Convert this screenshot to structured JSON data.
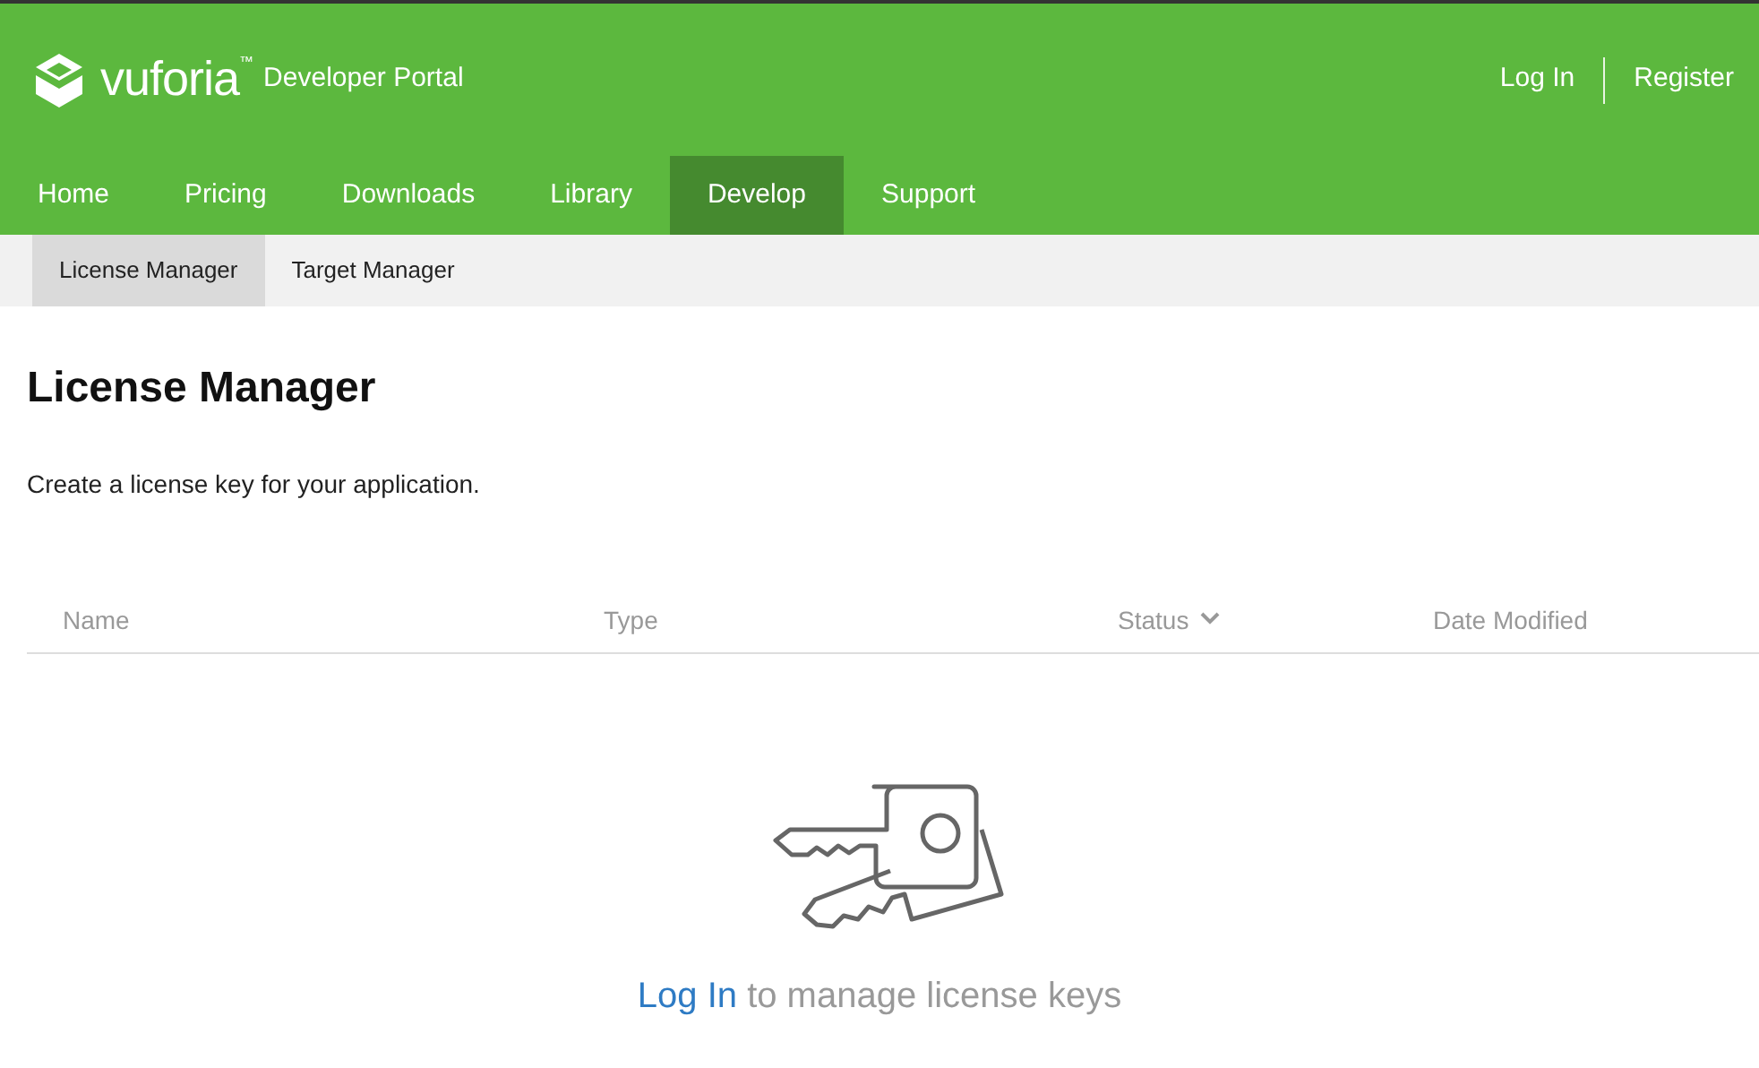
{
  "brand": {
    "name": "vuforia",
    "trademark": "™",
    "subtitle": "Developer Portal"
  },
  "account_links": [
    "Log In",
    "Register"
  ],
  "nav": [
    {
      "label": "Home",
      "selected": false
    },
    {
      "label": "Pricing",
      "selected": false
    },
    {
      "label": "Downloads",
      "selected": false
    },
    {
      "label": "Library",
      "selected": false
    },
    {
      "label": "Develop",
      "selected": true
    },
    {
      "label": "Support",
      "selected": false
    }
  ],
  "subnav": [
    {
      "label": "License Manager",
      "selected": true
    },
    {
      "label": "Target Manager",
      "selected": false
    }
  ],
  "heading": "License Manager",
  "description": "Create a license key for your application.",
  "table": {
    "columns": [
      {
        "label": "Name",
        "sorted": false
      },
      {
        "label": "Type",
        "sorted": false
      },
      {
        "label": "Status",
        "sorted": true
      },
      {
        "label": "Date Modified",
        "sorted": false
      }
    ]
  },
  "empty_state": {
    "link": "Log In",
    "text": "to manage license keys"
  }
}
